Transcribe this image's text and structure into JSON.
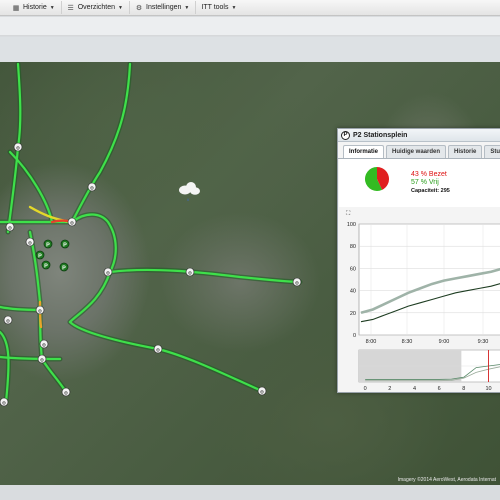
{
  "toolbar": {
    "items": [
      {
        "label": "Historie",
        "icon": "table-icon"
      },
      {
        "label": "Overzichten",
        "icon": "list-icon"
      },
      {
        "label": "Instellingen",
        "icon": "gear-icon"
      },
      {
        "label": "ITT tools",
        "icon": "none"
      }
    ]
  },
  "map": {
    "attribution": "Imagery ©2014 AeroWest, Aerodata Internat",
    "weather_icon": "cloud-icon"
  },
  "popup": {
    "title": "P2 Stationsplein",
    "icon_letter": "P",
    "tabs": [
      "Informatie",
      "Huidige waarden",
      "Historie",
      "Stu"
    ],
    "active_tab": 0,
    "occupied_text": "43 % Bezet",
    "free_text": "57 % Vrij",
    "capacity_text": "Capaciteit: 295",
    "occupied_pct": 43,
    "free_pct": 57,
    "colors": {
      "occupied": "#e02020",
      "free": "#33bb22"
    }
  },
  "chart_data": [
    {
      "type": "line",
      "x_ticks": [
        "8:00",
        "8:30",
        "9:00",
        "9:30"
      ],
      "y_ticks": [
        0,
        20,
        40,
        60,
        80,
        100
      ],
      "ylim": [
        0,
        100
      ],
      "grid": true,
      "series": [
        {
          "color": "#9fb3a8",
          "x": [
            0,
            1,
            2,
            3,
            4,
            5,
            6,
            7,
            8,
            9,
            10,
            11,
            12
          ],
          "values": [
            20,
            23,
            28,
            33,
            38,
            42,
            46,
            49,
            51,
            53,
            55,
            57,
            60
          ]
        },
        {
          "color": "#1e3d22",
          "x": [
            0,
            1,
            2,
            3,
            4,
            5,
            6,
            7,
            8,
            9,
            10,
            11,
            12
          ],
          "values": [
            12,
            14,
            18,
            22,
            26,
            29,
            32,
            35,
            38,
            40,
            42,
            44,
            47
          ]
        }
      ]
    },
    {
      "type": "area",
      "x_ticks": [
        "0",
        "2",
        "4",
        "6",
        "8",
        "10"
      ],
      "xlim": [
        -0.5,
        11.5
      ],
      "ylim": [
        0,
        100
      ],
      "series": [
        {
          "color": "#5a8a6a",
          "x": [
            0,
            2,
            4,
            6,
            7,
            8,
            9,
            10,
            11
          ],
          "values": [
            8,
            8,
            8,
            8,
            9,
            15,
            45,
            50,
            55
          ]
        },
        {
          "color": "#99aa99",
          "x": [
            0,
            2,
            4,
            6,
            7,
            8,
            9,
            10,
            11
          ],
          "values": [
            4,
            4,
            4,
            4,
            5,
            12,
            30,
            40,
            48
          ]
        }
      ]
    }
  ]
}
